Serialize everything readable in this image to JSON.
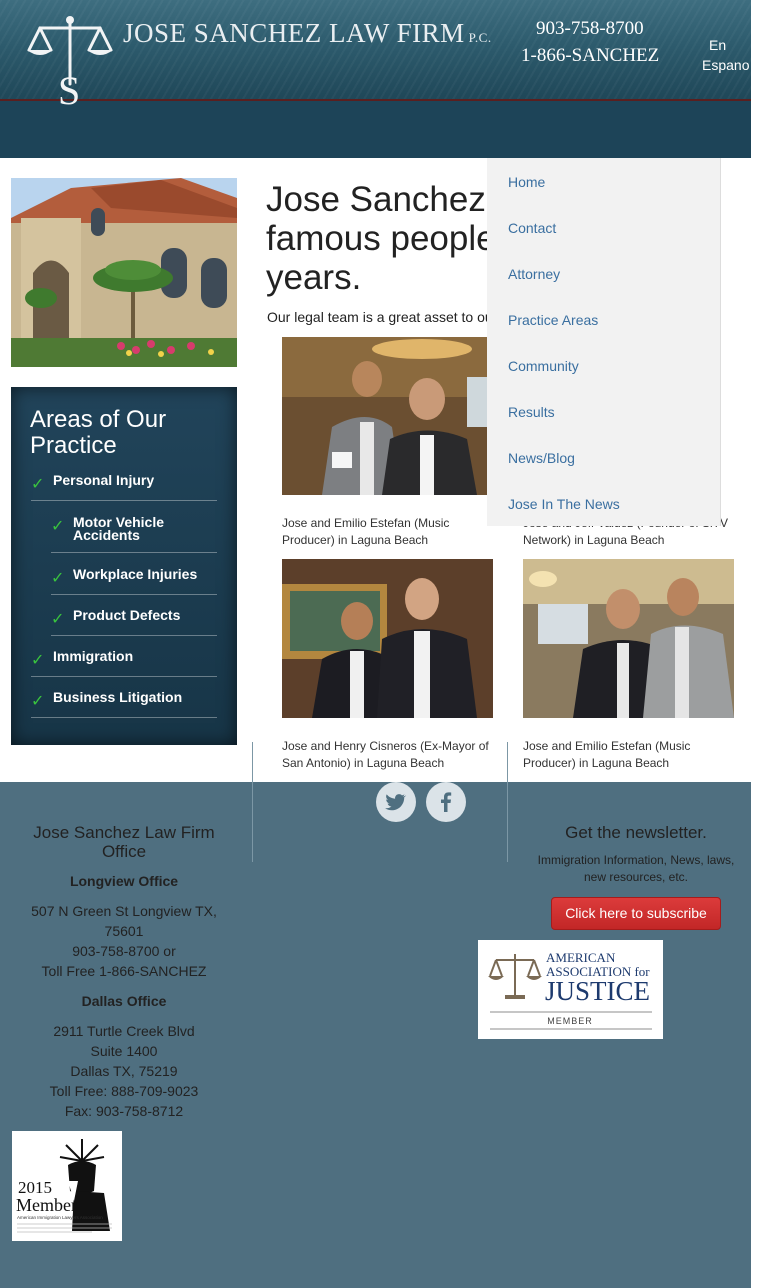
{
  "header": {
    "firm_name": "JOSE SANCHEZ LAW FIRM",
    "firm_suffix": "P.C.",
    "phone_1": "903-758-8700",
    "phone_2": "1-866-SANCHEZ",
    "lang_1": "En",
    "lang_2": "Espano"
  },
  "sidebar": {
    "areas_title": "Areas of Our Practice",
    "items": [
      {
        "label": "Personal Injury",
        "sub": false
      },
      {
        "label": "Motor Vehicle Accidents",
        "sub": true
      },
      {
        "label": "Workplace Injuries",
        "sub": true
      },
      {
        "label": "Product Defects",
        "sub": true
      },
      {
        "label": "Immigration",
        "sub": false
      },
      {
        "label": "Business Litigation",
        "sub": false
      }
    ]
  },
  "main": {
    "title_line_1": "Jose Sanchez",
    "title_line_2": "famous people",
    "title_line_3": "years.",
    "intro": "Our legal team is a great asset to our",
    "captions": [
      "Jose and Emilio Estefan (Music Producer) in Laguna Beach",
      "Jose and Jeff Valdez (Founder of SiTV Network) in Laguna Beach",
      "Jose and Henry Cisneros (Ex-Mayor of San Antonio) in Laguna Beach",
      "Jose and Emilio Estefan (Music Producer) in Laguna Beach"
    ]
  },
  "menu": {
    "items": [
      "Home",
      "Contact",
      "Attorney",
      "Practice Areas",
      "Community",
      "Results",
      "News/Blog",
      "Jose In The News"
    ]
  },
  "footer": {
    "office_title": "Jose Sanchez Law Firm Office",
    "longview_heading": "Longview Office",
    "longview_lines": [
      "507 N Green St Longview TX,",
      "75601",
      "903-758-8700 or",
      "Toll Free 1-866-SANCHEZ"
    ],
    "dallas_heading": "Dallas Office",
    "dallas_lines": [
      "2911 Turtle Creek Blvd",
      "Suite 1400",
      "Dallas TX, 75219",
      "Toll Free: 888-709-9023",
      "Fax: 903-758-8712"
    ],
    "newsletter_title": "Get the newsletter.",
    "newsletter_text": "Immigration Information, News, laws, new resources, etc.",
    "subscribe_label": "Click here to subscribe",
    "aaj_line_1": "AMERICAN",
    "aaj_line_2": "ASSOCIATION for",
    "aaj_line_3": "JUSTICE",
    "aaj_member": "MEMBER",
    "aila_year": "2015",
    "aila_member": "Member",
    "aila_org": "American Immigration Lawyers Association"
  },
  "icons": {
    "twitter": "twitter-icon",
    "facebook": "facebook-icon",
    "check": "check-icon"
  }
}
